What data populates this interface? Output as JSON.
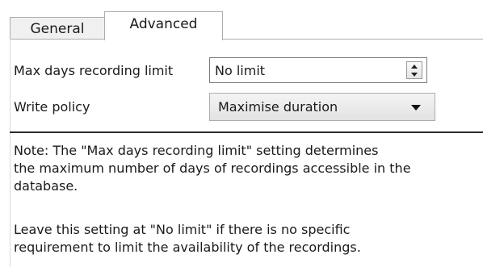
{
  "tabs": {
    "general": "General",
    "advanced": "Advanced"
  },
  "fields": {
    "max_days_label": "Max days recording limit",
    "max_days_value": "No limit",
    "write_policy_label": "Write policy",
    "write_policy_value": "Maximise duration"
  },
  "note": {
    "line1": "Note: The \"Max days recording limit\" setting determines",
    "line2": "the maximum number of days of recordings accessible in the",
    "line3": "database.",
    "line4": "Leave this setting at \"No limit\" if there is no specific",
    "line5": "requirement to limit the availability of the recordings."
  }
}
